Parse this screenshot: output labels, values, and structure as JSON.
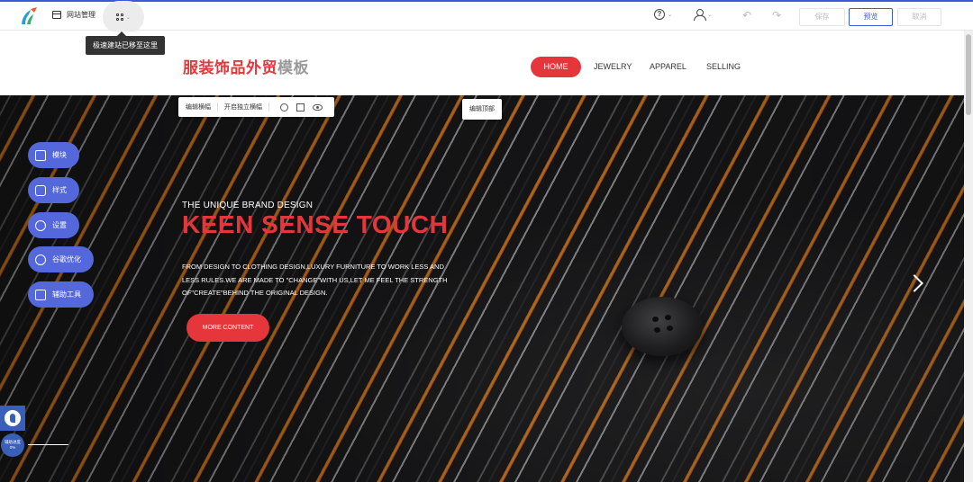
{
  "toolbar": {
    "site_manage_label": "网站管理",
    "tooltip": "极速建站已移至这里",
    "save_label": "保存",
    "preview_label": "预览",
    "cancel_label": "取消",
    "accent_color": "#3c5ad6"
  },
  "site": {
    "title_red": "服装饰品外贸",
    "title_grey": "模板",
    "brand_color": "#e5373b",
    "nav": [
      {
        "label": "HOME",
        "active": true
      },
      {
        "label": "JEWELRY",
        "active": false
      },
      {
        "label": "APPAREL",
        "active": false
      },
      {
        "label": "SELLING",
        "active": false
      }
    ]
  },
  "hero": {
    "kicker": "THE UNIQUE BRAND DESIGN",
    "headline": "KEEN SENSE TOUCH",
    "desc_lines": [
      "FROM DESIGN TO CLOTHING DESIGN,LUXURY FURNITURE TO WORK LESS AND",
      "LESS RULES.WE ARE MADE TO \"CHANGE\"WITH US,LET ME FEEL THE STRENGTH",
      "OF\"CREATE\"BEHIND THE ORIGINAL DESIGN."
    ],
    "more_label": "MORE CONTENT"
  },
  "editor": {
    "edit_carousel": "编辑横幅",
    "enable_independent_carousel": "开启独立横幅",
    "edit_top": "编辑顶部"
  },
  "side_menu": [
    {
      "label": "模块",
      "icon": "module-icon"
    },
    {
      "label": "样式",
      "icon": "shirt-icon"
    },
    {
      "label": "设置",
      "icon": "settings-icon"
    },
    {
      "label": "谷歌优化",
      "icon": "google-icon"
    },
    {
      "label": "辅助工具",
      "icon": "tools-icon"
    }
  ],
  "progress": {
    "label": "辅助进度",
    "value": "0%"
  }
}
